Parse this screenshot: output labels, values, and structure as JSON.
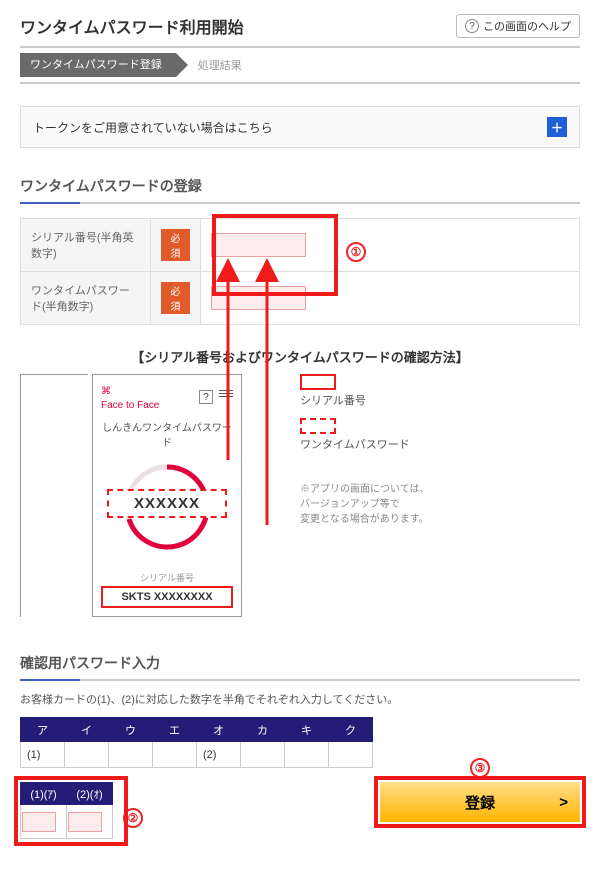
{
  "header": {
    "title": "ワンタイムパスワード利用開始",
    "help_label": "この画面のヘルプ"
  },
  "steps": {
    "current": "ワンタイムパスワード登録",
    "next": "処理結果"
  },
  "expand": {
    "text": "トークンをご用意されていない場合はこちら",
    "plus": "＋"
  },
  "form_section": {
    "title": "ワンタイムパスワードの登録",
    "serial_label": "シリアル番号(半角英数字)",
    "otp_label": "ワンタイムパスワード(半角数字)",
    "required": "必須",
    "callout1": "①"
  },
  "phone": {
    "heading": "【シリアル番号およびワンタイムパスワードの確認方法】",
    "brand_top": "⌘",
    "brand_name": "Face to Face",
    "mini_title": "しんきんワンタイムパスワード",
    "otp_sample": "XXXXXX",
    "serial_lbl": "シリアル番号",
    "serial_sample": "SKTS XXXXXXXX",
    "legend_serial": "シリアル番号",
    "legend_otp": "ワンタイムパスワード",
    "note1": "※アプリの画面については、",
    "note2": "バージョンアップ等で",
    "note3": "変更となる場合があります。"
  },
  "confirm_section": {
    "title": "確認用パスワード入力",
    "instruction": "お客様カードの(1)、(2)に対応した数字を半角でそれぞれ入力してください。",
    "cols": [
      "ア",
      "イ",
      "ウ",
      "エ",
      "オ",
      "カ",
      "キ",
      "ク"
    ],
    "cells": [
      "(1)",
      "",
      "",
      "",
      "(2)",
      "",
      "",
      ""
    ],
    "mini_headers": [
      "(1)(ｱ)",
      "(2)(ｵ)"
    ],
    "callout2": "②"
  },
  "submit": {
    "label": "登録",
    "chev": ">",
    "callout3": "③"
  }
}
